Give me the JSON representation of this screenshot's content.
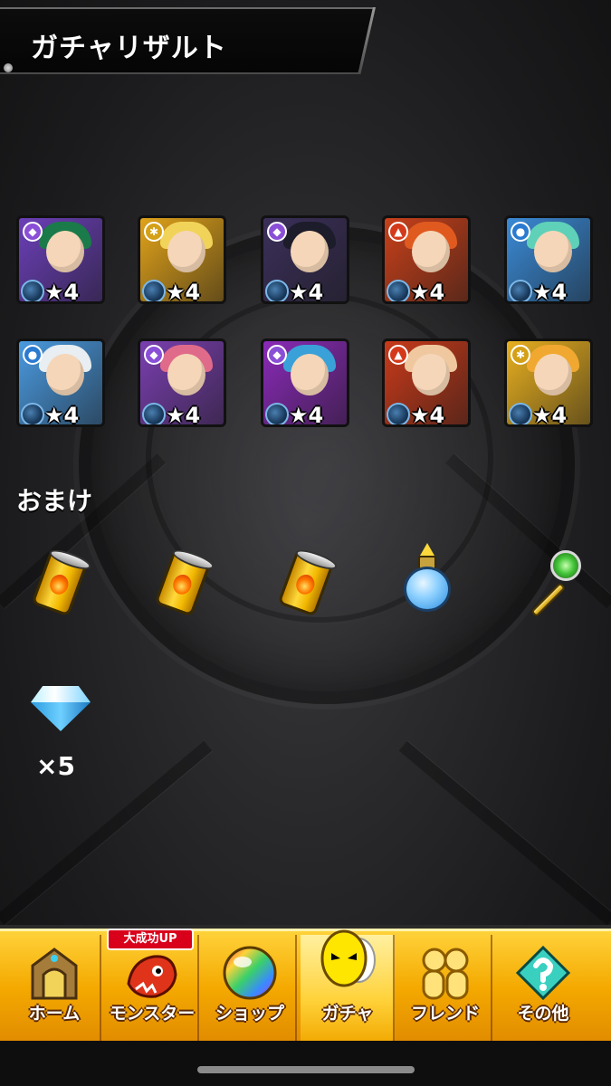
{
  "header": {
    "title": "ガチャリザルト"
  },
  "monsters": [
    {
      "stars": "★4",
      "element": "dark",
      "elem_symbol": "◆",
      "bg": "#6b3fb8",
      "hair": "#1a7a4a",
      "elem_color": "#8a4fd6"
    },
    {
      "stars": "★4",
      "element": "light",
      "elem_symbol": "✱",
      "bg": "#e0a21a",
      "hair": "#f2d35a",
      "elem_color": "#d4a017"
    },
    {
      "stars": "★4",
      "element": "dark",
      "elem_symbol": "◆",
      "bg": "#3b2f5a",
      "hair": "#1c1c2a",
      "elem_color": "#8a4fd6"
    },
    {
      "stars": "★4",
      "element": "fire",
      "elem_symbol": "▲",
      "bg": "#c8401a",
      "hair": "#e05a20",
      "elem_color": "#d43a1a"
    },
    {
      "stars": "★4",
      "element": "water",
      "elem_symbol": "●",
      "bg": "#3a8ad6",
      "hair": "#5fd1b8",
      "elem_color": "#2a7ad0"
    },
    {
      "stars": "★4",
      "element": "water",
      "elem_symbol": "●",
      "bg": "#4a9ae0",
      "hair": "#e8eef2",
      "elem_color": "#2a7ad0"
    },
    {
      "stars": "★4",
      "element": "dark",
      "elem_symbol": "◆",
      "bg": "#7a3fb0",
      "hair": "#e06a8a",
      "elem_color": "#8a4fd6"
    },
    {
      "stars": "★4",
      "element": "dark",
      "elem_symbol": "◆",
      "bg": "#8a2ab8",
      "hair": "#3aa0d8",
      "elem_color": "#8a4fd6"
    },
    {
      "stars": "★4",
      "element": "fire",
      "elem_symbol": "▲",
      "bg": "#c83a1a",
      "hair": "#f0c8a0",
      "elem_color": "#d43a1a"
    },
    {
      "stars": "★4",
      "element": "light",
      "elem_symbol": "✱",
      "bg": "#e8b020",
      "hair": "#f0a830",
      "elem_color": "#d4a017"
    }
  ],
  "bonus": {
    "label": "おまけ",
    "items": [
      {
        "icon": "fire-can-icon"
      },
      {
        "icon": "fire-can-icon"
      },
      {
        "icon": "fire-can-icon"
      },
      {
        "icon": "potion-flask-icon"
      },
      {
        "icon": "key-icon"
      }
    ],
    "gem_count": "×5"
  },
  "nav": {
    "badge": "大成功UP",
    "items": [
      {
        "label": "ホーム",
        "icon": "home-gate-icon"
      },
      {
        "label": "モンスター",
        "icon": "dragon-icon"
      },
      {
        "label": "ショップ",
        "icon": "rainbow-orb-icon"
      },
      {
        "label": "ガチャ",
        "icon": "gacha-egg-icon"
      },
      {
        "label": "フレンド",
        "icon": "friends-icon"
      },
      {
        "label": "その他",
        "icon": "other-menu-icon"
      }
    ]
  }
}
